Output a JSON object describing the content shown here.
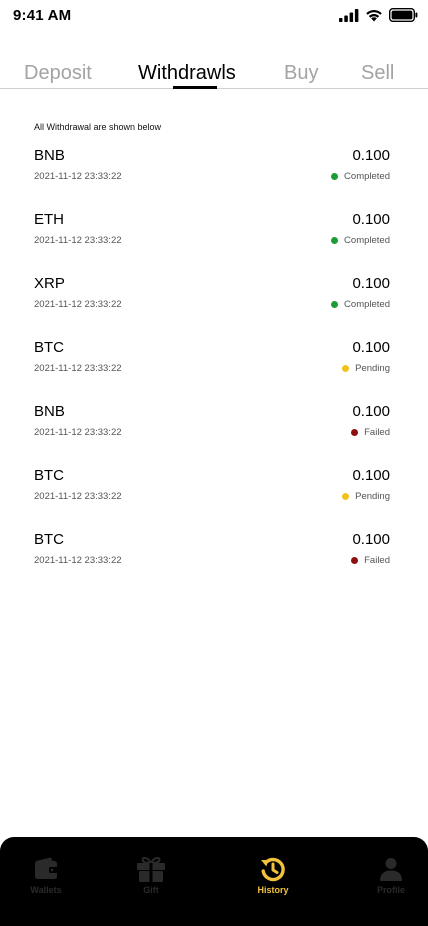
{
  "status_bar": {
    "time": "9:41 AM"
  },
  "tabs": [
    {
      "label": "Deposit",
      "active": false
    },
    {
      "label": "Withdrawls",
      "active": true
    },
    {
      "label": "Buy",
      "active": false
    },
    {
      "label": "Sell",
      "active": false
    }
  ],
  "list": {
    "caption": "All Withdrawal are shown below",
    "items": [
      {
        "asset": "BNB",
        "date": "2021-11-12 23:33:22",
        "amount": "0.100",
        "status": "Completed",
        "status_color": "#1e9e32"
      },
      {
        "asset": "ETH",
        "date": "2021-11-12 23:33:22",
        "amount": "0.100",
        "status": "Completed",
        "status_color": "#1e9e32"
      },
      {
        "asset": "XRP",
        "date": "2021-11-12 23:33:22",
        "amount": "0.100",
        "status": "Completed",
        "status_color": "#1e9e32"
      },
      {
        "asset": "BTC",
        "date": "2021-11-12 23:33:22",
        "amount": "0.100",
        "status": "Pending",
        "status_color": "#f2c21c"
      },
      {
        "asset": "BNB",
        "date": "2021-11-12 23:33:22",
        "amount": "0.100",
        "status": "Failed",
        "status_color": "#8f1010"
      },
      {
        "asset": "BTC",
        "date": "2021-11-12 23:33:22",
        "amount": "0.100",
        "status": "Pending",
        "status_color": "#f2c21c"
      },
      {
        "asset": "BTC",
        "date": "2021-11-12 23:33:22",
        "amount": "0.100",
        "status": "Failed",
        "status_color": "#8f1010"
      }
    ]
  },
  "bottom_nav": {
    "items": [
      {
        "label": "Wallets",
        "icon": "wallet-icon",
        "active": false
      },
      {
        "label": "Gift",
        "icon": "gift-icon",
        "active": false
      },
      {
        "label": "History",
        "icon": "history-icon",
        "active": true
      },
      {
        "label": "Profile",
        "icon": "profile-icon",
        "active": false
      }
    ],
    "active_color": "#f2c23b",
    "inactive_color": "#2a2a2a"
  }
}
